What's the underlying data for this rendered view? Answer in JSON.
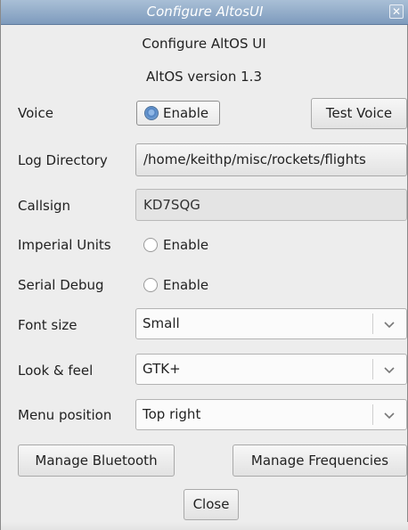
{
  "window": {
    "title": "Configure AltosUI",
    "close_glyph": "✕"
  },
  "header": {
    "title": "Configure AltOS UI",
    "version": "AltOS version 1.3"
  },
  "voice": {
    "label": "Voice",
    "enable_label": "Enable",
    "enabled": true,
    "test_button": "Test Voice"
  },
  "log_directory": {
    "label": "Log Directory",
    "path": "/home/keithp/misc/rockets/flights"
  },
  "callsign": {
    "label": "Callsign",
    "value": "KD7SQG"
  },
  "imperial_units": {
    "label": "Imperial Units",
    "enable_label": "Enable",
    "enabled": false
  },
  "serial_debug": {
    "label": "Serial Debug",
    "enable_label": "Enable",
    "enabled": false
  },
  "font_size": {
    "label": "Font size",
    "value": "Small"
  },
  "look_feel": {
    "label": "Look & feel",
    "value": "GTK+"
  },
  "menu_position": {
    "label": "Menu position",
    "value": "Top right"
  },
  "buttons": {
    "manage_bluetooth": "Manage Bluetooth",
    "manage_frequencies": "Manage Frequencies",
    "close": "Close"
  },
  "colors": {
    "titlebar": "#8aa5c4",
    "radio_selected": "#4f81c0"
  },
  "icons": {
    "dropdown": "chevron-down-icon",
    "window_close": "close-icon"
  }
}
